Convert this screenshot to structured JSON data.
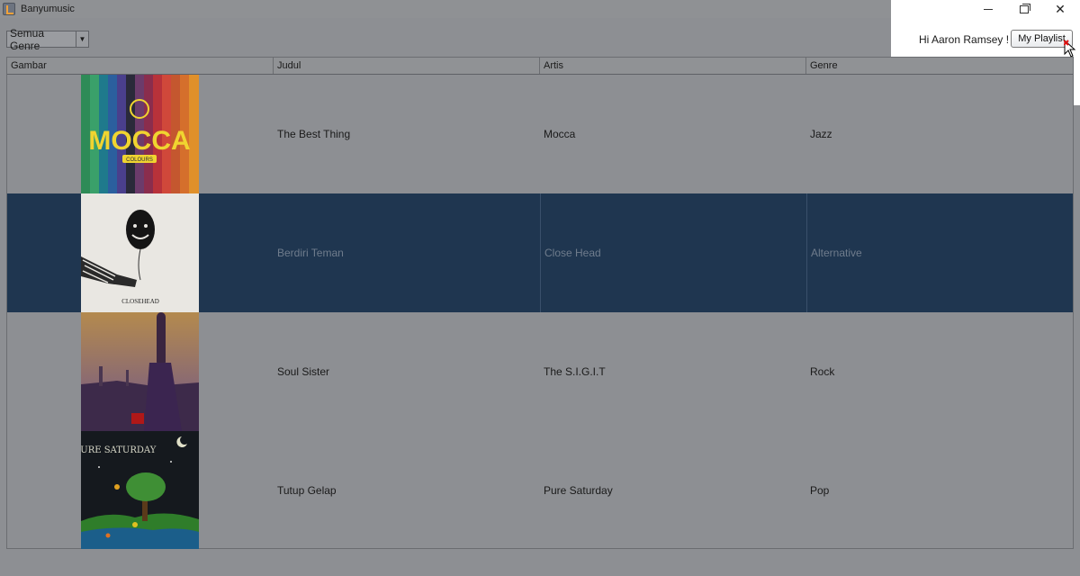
{
  "window": {
    "title": "Banyumusic"
  },
  "toolbar": {
    "genre_selected": "Semua Genre",
    "greeting": "Hi Aaron Ramsey !",
    "playlist_label": "My Playlist"
  },
  "table": {
    "columns": [
      "Gambar",
      "Judul",
      "Artis",
      "Genre"
    ],
    "rows": [
      {
        "title": "The Best Thing",
        "artist": "Mocca",
        "genre": "Jazz",
        "cover": "mocca-colours-cover",
        "cover_text": "MOCCA",
        "cover_subtext": "COLOURS"
      },
      {
        "title": "Berdiri Teman",
        "artist": "Close Head",
        "genre": "Alternative",
        "cover": "closehead-balloon-cover",
        "cover_text": "CLOSEHEAD"
      },
      {
        "title": "Soul Sister",
        "artist": "The S.I.G.I.T",
        "genre": "Rock",
        "cover": "sigit-landscape-cover"
      },
      {
        "title": "Tutup Gelap",
        "artist": "Pure Saturday",
        "genre": "Pop",
        "cover": "pure-saturday-cover",
        "cover_text": "PURE SATURDAY"
      }
    ],
    "selected_row": 1
  },
  "colors": {
    "window_bg": "#8d8f93",
    "selected_row": "#1f3650",
    "overlay": "#ffffff"
  }
}
